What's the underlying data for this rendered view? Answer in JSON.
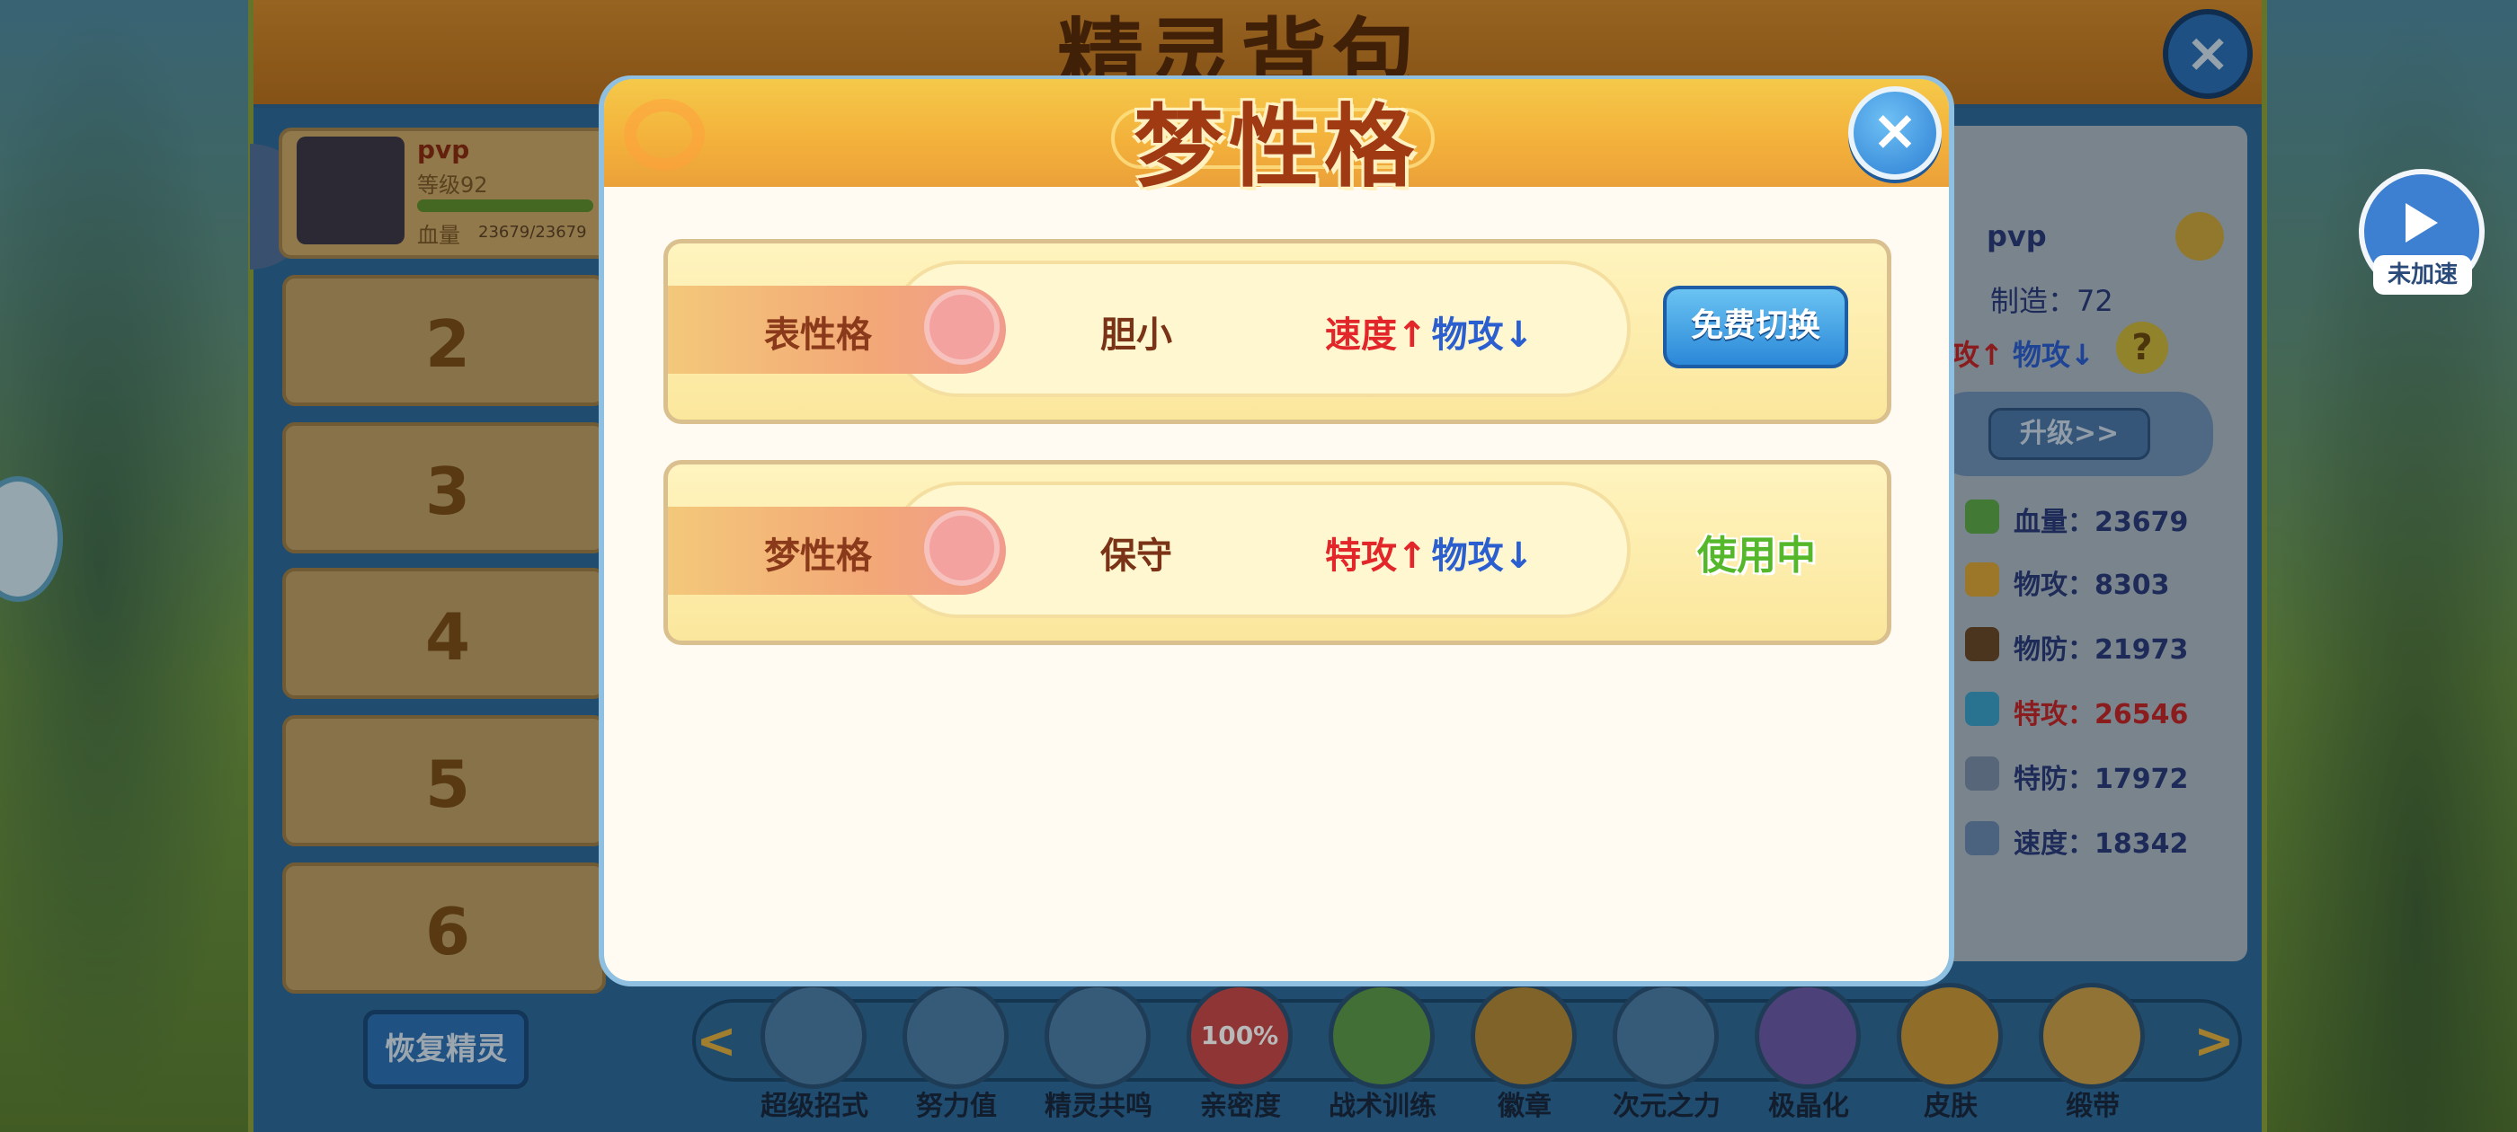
{
  "main_panel": {
    "title": "精灵背包",
    "close_symbol": "×",
    "pet": {
      "name": "pvp",
      "level": "等级92",
      "hp_label": "血量",
      "hp_value": "23679/23679"
    },
    "slots": [
      "2",
      "3",
      "4",
      "5",
      "6"
    ],
    "restore_button": "恢复精灵"
  },
  "right_panel": {
    "name": "pvp",
    "made_by": "制造：72",
    "nature_up_partial": "攻",
    "nature_down": "物攻",
    "help_symbol": "?",
    "upgrade_button": "升级>>",
    "stats": [
      {
        "label": "血量：",
        "value": "23679",
        "icon": "leaf-icon",
        "color": "#2a3b7a"
      },
      {
        "label": "物攻：",
        "value": "8303",
        "icon": "swords-icon",
        "color": "#2a3b7a"
      },
      {
        "label": "物防：",
        "value": "21973",
        "icon": "shield-icon",
        "color": "#2a3b7a"
      },
      {
        "label": "特攻：",
        "value": "26546",
        "icon": "flame-icon",
        "color": "#c0282a"
      },
      {
        "label": "特防：",
        "value": "17972",
        "icon": "guard-icon",
        "color": "#2a3b7a"
      },
      {
        "label": "速度：",
        "value": "18342",
        "icon": "wing-icon",
        "color": "#2a3b7a"
      }
    ]
  },
  "skill_bar": {
    "prev_arrow": "<",
    "next_arrow": ">",
    "items": [
      {
        "label": "超级招式",
        "icon": "super-move-icon"
      },
      {
        "label": "努力值",
        "icon": "effort-icon"
      },
      {
        "label": "精灵共鸣",
        "icon": "resonance-icon"
      },
      {
        "label": "亲密度",
        "icon": "heart-icon",
        "badge": "100%"
      },
      {
        "label": "战术训练",
        "icon": "training-icon"
      },
      {
        "label": "徽章",
        "icon": "badge-icon"
      },
      {
        "label": "次元之力",
        "icon": "dimension-icon"
      },
      {
        "label": "极晶化",
        "icon": "crystal-icon"
      },
      {
        "label": "皮肤",
        "icon": "skin-icon"
      },
      {
        "label": "缎带",
        "icon": "ribbon-icon"
      }
    ]
  },
  "speed_button": {
    "label": "未加速",
    "icon": "play-icon"
  },
  "dialog": {
    "title": "梦性格",
    "close_symbol": "×",
    "rows": [
      {
        "tag": "表性格",
        "nature": "胆小",
        "up_stat": "速度",
        "up_arrow": "↑",
        "down_stat": "物攻",
        "down_arrow": "↓",
        "action": "免费切换",
        "action_type": "button"
      },
      {
        "tag": "梦性格",
        "nature": "保守",
        "up_stat": "特攻",
        "up_arrow": "↑",
        "down_stat": "物攻",
        "down_arrow": "↓",
        "action": "使用中",
        "action_type": "status"
      }
    ]
  },
  "colors": {
    "accent_up": "#e2262a",
    "accent_down": "#2b5fd0",
    "in_use": "#55b82a",
    "button_blue": "#2b88d8"
  }
}
